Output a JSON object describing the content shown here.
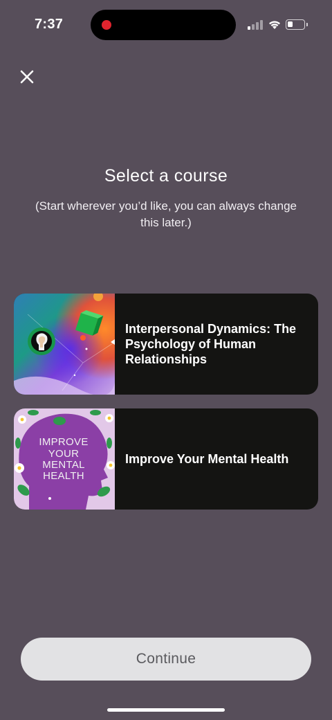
{
  "status_bar": {
    "time": "7:37",
    "icons": [
      "recording-dot-icon",
      "cellular-signal-icon",
      "wifi-icon",
      "battery-icon"
    ]
  },
  "header": {
    "close_icon": "close-icon",
    "title": "Select a course",
    "subtitle": "(Start wherever you’d like, you can always change this later.)"
  },
  "courses": [
    {
      "title": "Interpersonal Dynamics: The Psychology of Human Relationships",
      "thumbnail": "abstract-gradient-head-illustration"
    },
    {
      "title": "Improve Your Mental Health",
      "thumbnail": "purple-head-with-flowers-illustration",
      "thumbnail_text": [
        "IMPROVE",
        "YOUR",
        "MENTAL",
        "HEALTH"
      ]
    }
  ],
  "footer": {
    "continue_label": "Continue"
  },
  "colors": {
    "background": "#574e5a",
    "card": "#141412",
    "button": "#e2e2e4",
    "button_text": "#5a5a5e"
  }
}
